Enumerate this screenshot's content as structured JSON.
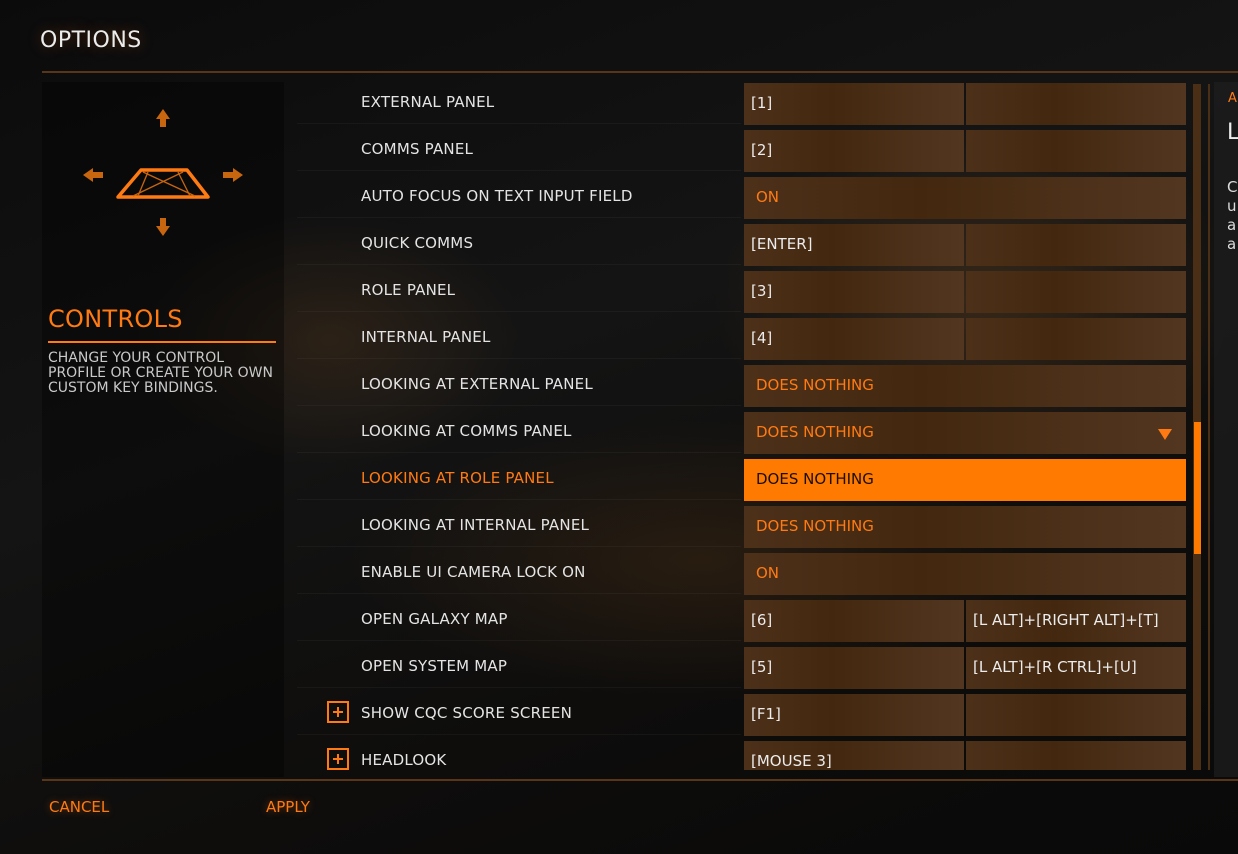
{
  "header": {
    "title": "OPTIONS"
  },
  "sidebar": {
    "section_title": "CONTROLS",
    "section_description": "CHANGE YOUR CONTROL PROFILE OR CREATE YOUR OWN CUSTOM KEY BINDINGS.",
    "graphic": "ship-directional-icon"
  },
  "bindings": [
    {
      "label": "EXTERNAL PANEL",
      "primary": "[1]",
      "secondary": "",
      "type": "key"
    },
    {
      "label": "COMMS PANEL",
      "primary": "[2]",
      "secondary": "",
      "type": "key"
    },
    {
      "label": "AUTO FOCUS ON TEXT INPUT FIELD",
      "value": "ON",
      "type": "toggle"
    },
    {
      "label": "QUICK COMMS",
      "primary": "[ENTER]",
      "secondary": "",
      "type": "key"
    },
    {
      "label": "ROLE PANEL",
      "primary": "[3]",
      "secondary": "",
      "type": "key"
    },
    {
      "label": "INTERNAL PANEL",
      "primary": "[4]",
      "secondary": "",
      "type": "key"
    },
    {
      "label": "LOOKING AT EXTERNAL PANEL",
      "value": "DOES NOTHING",
      "type": "select"
    },
    {
      "label": "LOOKING AT COMMS PANEL",
      "value": "DOES NOTHING",
      "type": "select-open"
    },
    {
      "label": "LOOKING AT ROLE PANEL",
      "value": "DOES NOTHING",
      "type": "select-highlight",
      "active": true
    },
    {
      "label": "LOOKING AT INTERNAL PANEL",
      "value": "DOES NOTHING",
      "type": "select"
    },
    {
      "label": "ENABLE UI CAMERA LOCK ON",
      "value": "ON",
      "type": "toggle"
    },
    {
      "label": "OPEN GALAXY MAP",
      "primary": "[6]",
      "secondary": "[L ALT]+[RIGHT ALT]+[T]",
      "type": "key"
    },
    {
      "label": "OPEN SYSTEM MAP",
      "primary": "[5]",
      "secondary": "[L ALT]+[R CTRL]+[U]",
      "type": "key"
    },
    {
      "label": "SHOW CQC SCORE SCREEN",
      "primary": "[F1]",
      "secondary": "",
      "type": "key",
      "expandable": true
    },
    {
      "label": "HEADLOOK",
      "primary": "[MOUSE 3]",
      "secondary": "",
      "type": "key",
      "expandable": true
    }
  ],
  "scroll": {
    "position_fraction": 0.49,
    "visible_fraction": 0.19
  },
  "info_panel": {
    "category": "A",
    "title": "L",
    "text_lines": [
      "C",
      "u",
      "a",
      "a"
    ]
  },
  "footer": {
    "cancel_label": "CANCEL",
    "apply_label": "APPLY"
  },
  "colors": {
    "accent": "#ff7a00",
    "cell_bg": "#4a2e17",
    "text": "#e4e4e4"
  }
}
